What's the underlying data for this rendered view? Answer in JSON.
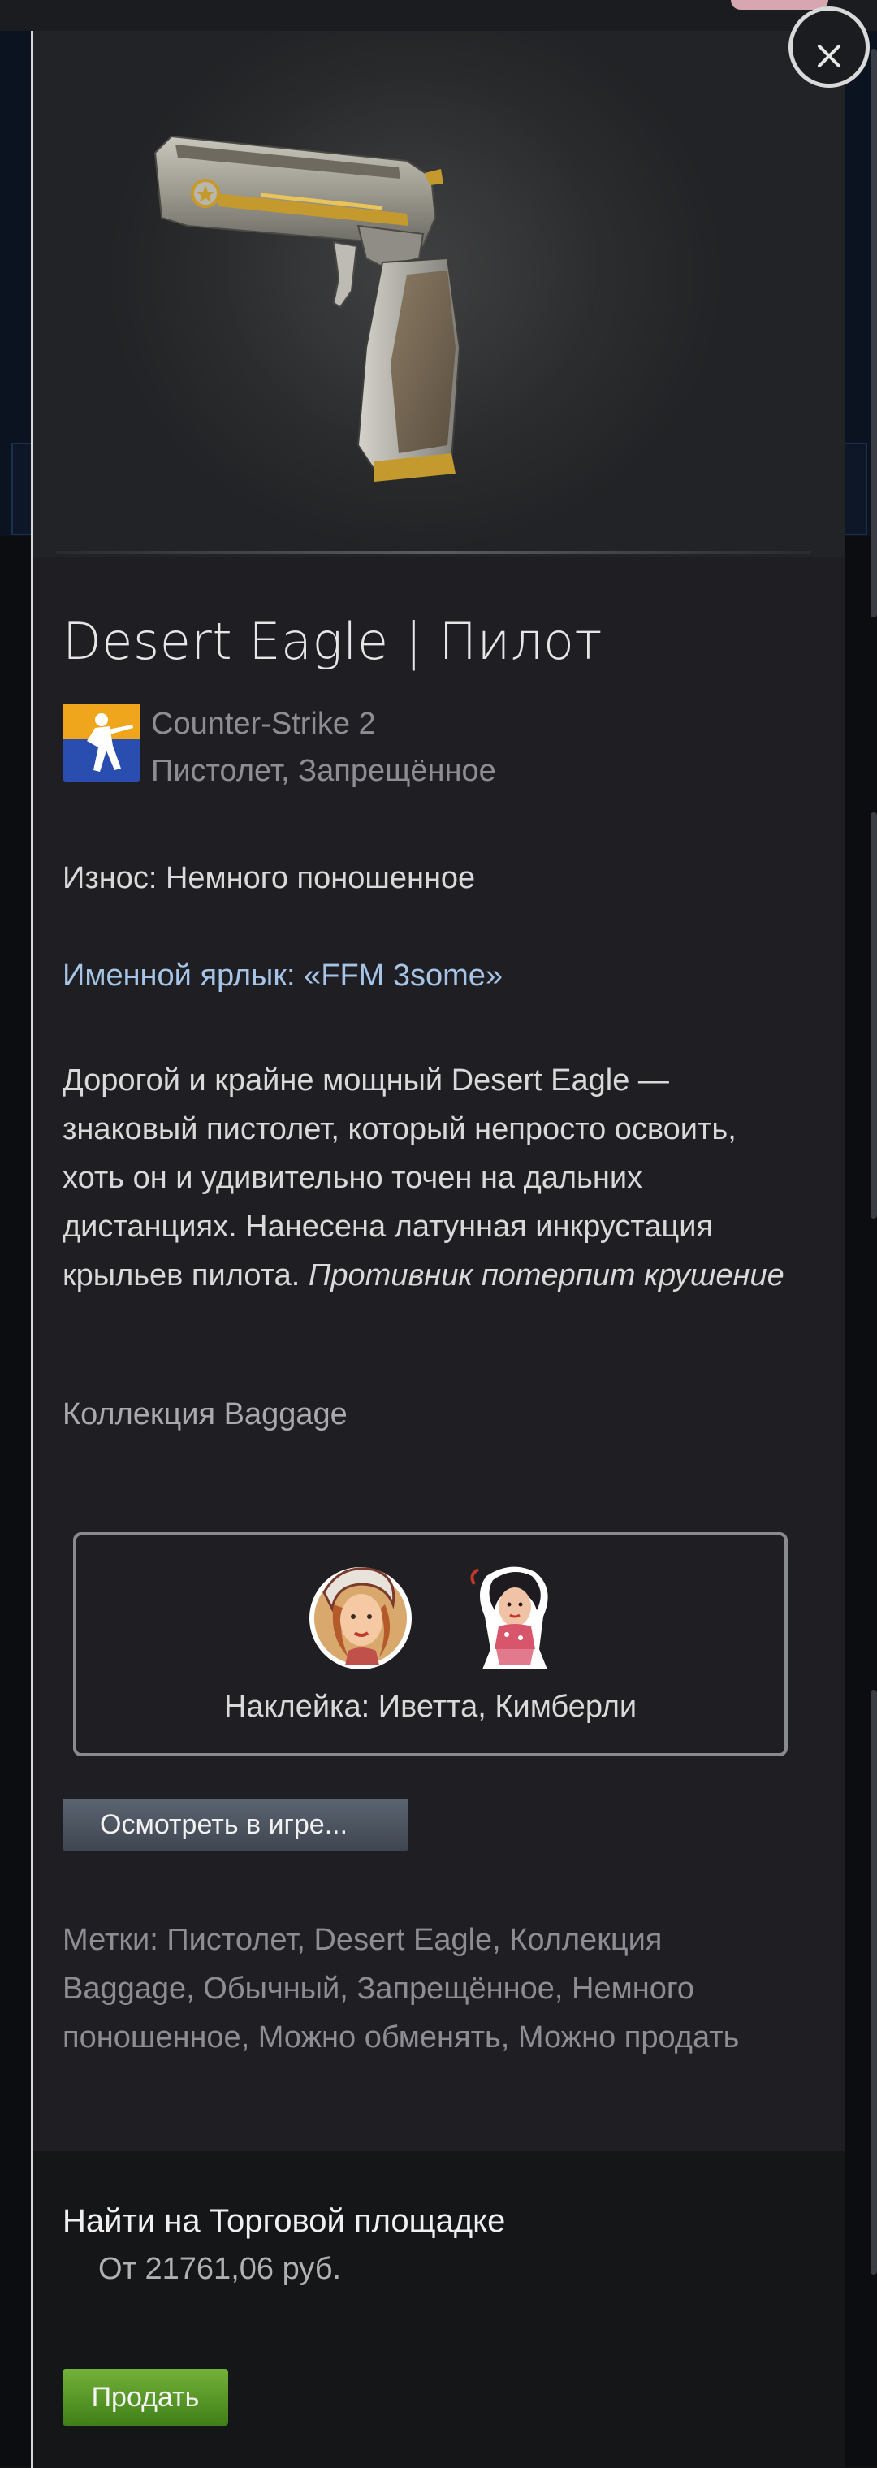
{
  "item": {
    "title": "Desert Eagle | Пилот",
    "game": "Counter-Strike 2",
    "type": "Пистолет, Запрещённое",
    "wear": "Износ: Немного поношенное",
    "name_tag": "Именной ярлык: «FFM 3some»",
    "description": "Дорогой и крайне мощный Desert Eagle — знаковый пистолет, который непросто освоить, хоть он и удивительно точен на дальних дистанциях. Нанесена латунная инкрустация крыльев пилота. ",
    "description_italic": "Противник потерпит крушение",
    "collection": "Коллекция Baggage"
  },
  "stickers": {
    "label": "Наклейка: Иветта, Кимберли",
    "items": [
      "Иветта",
      "Кимберли"
    ]
  },
  "buttons": {
    "inspect": "Осмотреть в игре...",
    "sell": "Продать",
    "close_icon": "close-icon"
  },
  "tags": "Метки: Пистолет, Desert Eagle, Коллекция Baggage, Обычный, Запрещённое, Немного поношенное, Можно обменять, Можно продать",
  "market": {
    "title": "Найти на Торговой площадке",
    "price": "От 21761,06 руб."
  },
  "colors": {
    "panel_bg": "#1f1e23",
    "name_tag": "#a6c5e6",
    "sell_green": "#5c9a28",
    "muted_text": "#8d8e93"
  }
}
